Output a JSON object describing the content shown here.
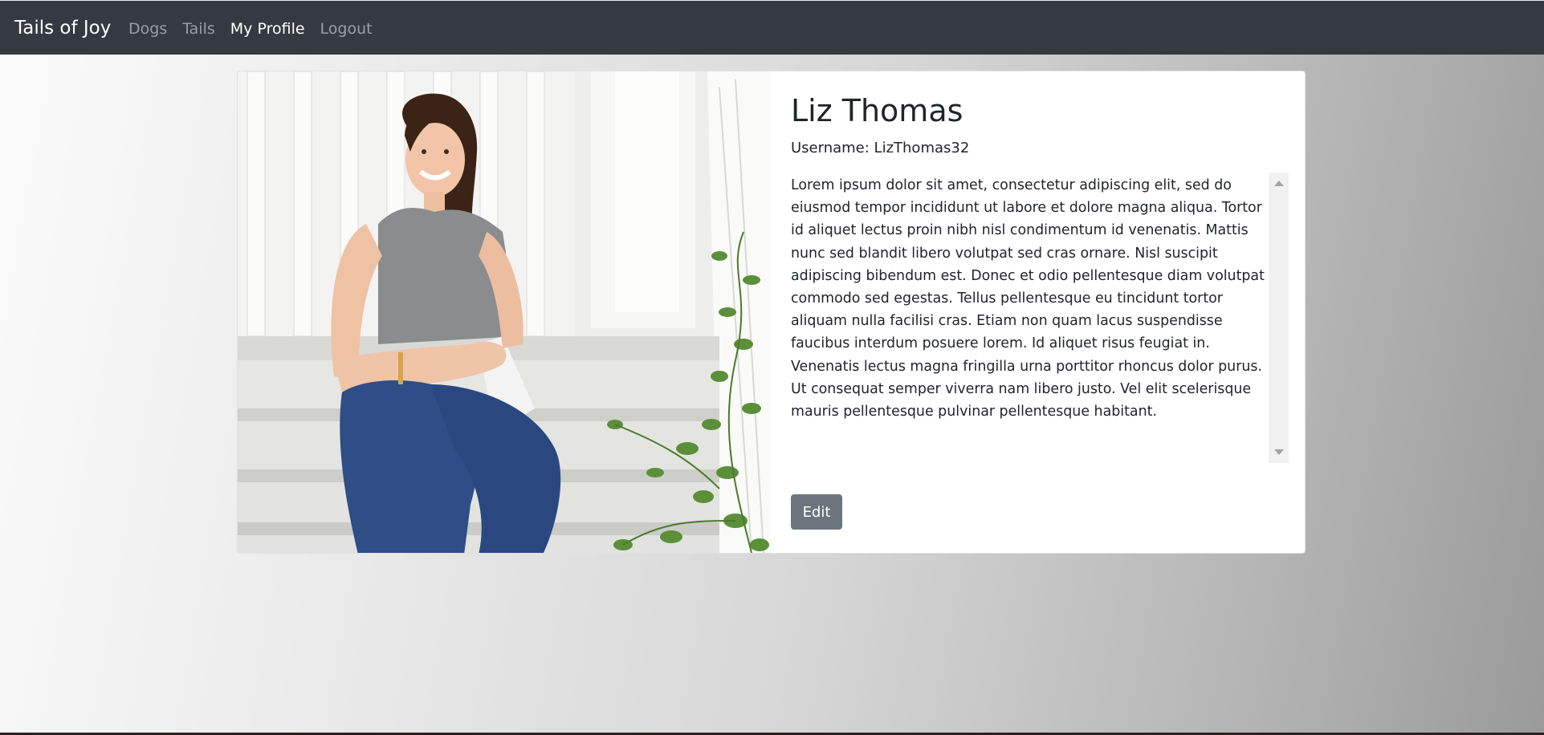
{
  "app": {
    "brand": "Tails of Joy"
  },
  "nav": {
    "items": [
      {
        "label": "Dogs",
        "active": false
      },
      {
        "label": "Tails",
        "active": false
      },
      {
        "label": "My Profile",
        "active": true
      },
      {
        "label": "Logout",
        "active": false
      }
    ]
  },
  "profile": {
    "name": "Liz Thomas",
    "username_line": "Username: LizThomas32",
    "bio": "Lorem ipsum dolor sit amet, consectetur adipiscing elit, sed do eiusmod tempor incididunt ut labore et dolore magna aliqua. Tortor id aliquet lectus proin nibh nisl condimentum id venenatis. Mattis nunc sed blandit libero volutpat sed cras ornare. Nisl suscipit adipiscing bibendum est. Donec et odio pellentesque diam volutpat commodo sed egestas. Tellus pellentesque eu tincidunt tortor aliquam nulla facilisi cras. Etiam non quam lacus suspendisse faucibus interdum posuere lorem. Id aliquet risus feugiat in. Venenatis lectus magna fringilla urna porttitor rhoncus dolor purus. Ut consequat semper viverra nam libero justo. Vel elit scelerisque mauris pellentesque pulvinar pellentesque habitant.",
    "edit_label": "Edit"
  },
  "icons": {
    "scroll_up": "scroll-up-arrow-icon",
    "scroll_down": "scroll-down-arrow-icon"
  },
  "colors": {
    "navbar": "#343a40",
    "button_secondary": "#6c757d",
    "text": "#212529"
  }
}
